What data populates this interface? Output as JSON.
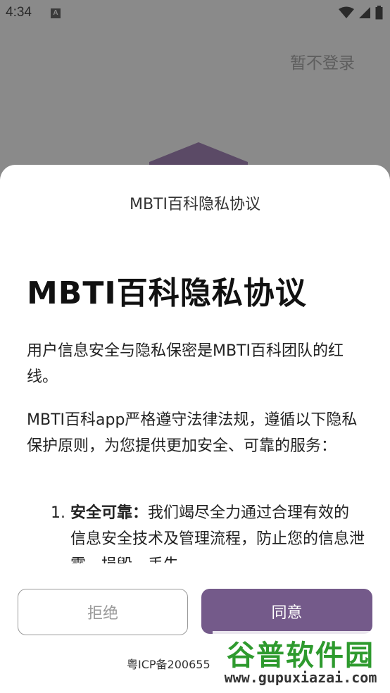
{
  "status": {
    "time": "4:34",
    "notification_icon": "A"
  },
  "header": {
    "skip_login": "暂不登录"
  },
  "dialog": {
    "title": "MBTI百科隐私协议",
    "heading": "MBTI百科隐私协议",
    "paragraph1": "用户信息安全与隐私保密是MBTI百科团队的红线。",
    "paragraph2": "MBTI百科app严格遵守法律法规，遵循以下隐私保护原则，为您提供更加安全、可靠的服务：",
    "list": [
      {
        "number": "1.",
        "strong": "安全可靠：",
        "text": "我们竭尽全力通过合理有效的信息安全技术及管理流程，防止您的信息泄露、损毁、丢失。"
      }
    ],
    "reject_label": "拒绝",
    "agree_label": "同意",
    "icp": "粤ICP备200655"
  },
  "watermark": {
    "name": "谷普软件园",
    "url": "www.gupuxiazai.com"
  },
  "colors": {
    "accent": "#745a8a",
    "overlay": "#8a8a8a"
  }
}
